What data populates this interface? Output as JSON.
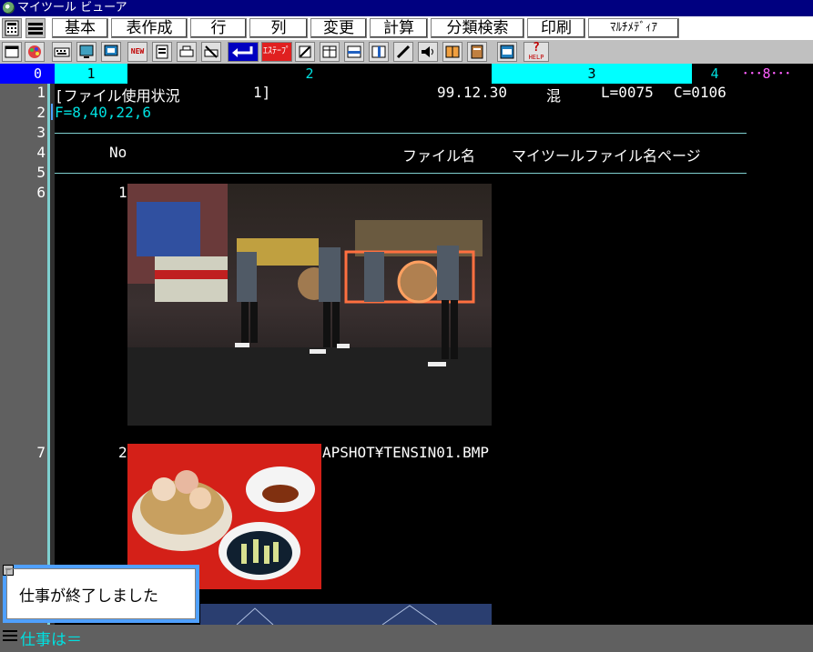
{
  "window": {
    "title": "マイツール ビューア"
  },
  "menu": {
    "items": [
      "基本",
      "表作成",
      "行",
      "列",
      "変更",
      "計算",
      "分類検索",
      "印刷",
      "ﾏﾙﾁﾒﾃﾞｨｱ"
    ]
  },
  "toolbar": {
    "new_label": "NEW",
    "tape_label": "ｴｽﾃｰﾌﾟ",
    "help_label": "HELP",
    "help_mark": "?"
  },
  "ruler": {
    "segments": [
      "0",
      "1",
      "2",
      "3",
      "4",
      "･･･8･･･"
    ]
  },
  "lines": {
    "n1": "1",
    "n2": "2",
    "n3": "3",
    "n4": "4",
    "n5": "5",
    "n6": "6",
    "n7": "7",
    "l1_title": "[ファイル使用状況",
    "l1_num": "1]",
    "l1_date": "99.12.30",
    "l1_mode": "混",
    "l1_L": "L=0075",
    "l1_C": "C=0106",
    "l2_format": "F=8,40,22,6",
    "h_no": "No",
    "h_filename": "ファイル名",
    "h_myfile": "マイツールファイル名ページ",
    "r1_no": "1",
    "r2_no": "2",
    "r2_filename": "APSHOT¥TENSIN01.BMP"
  },
  "status": {
    "prompt": "仕事は＝"
  },
  "dialog": {
    "message": "仕事が終了しました",
    "close": "−"
  },
  "colors": {
    "title_bg": "#000080",
    "ruler_cyan": "#00ffff",
    "ruler_blue": "#0000ff",
    "text_cyan": "#00e0e0"
  }
}
